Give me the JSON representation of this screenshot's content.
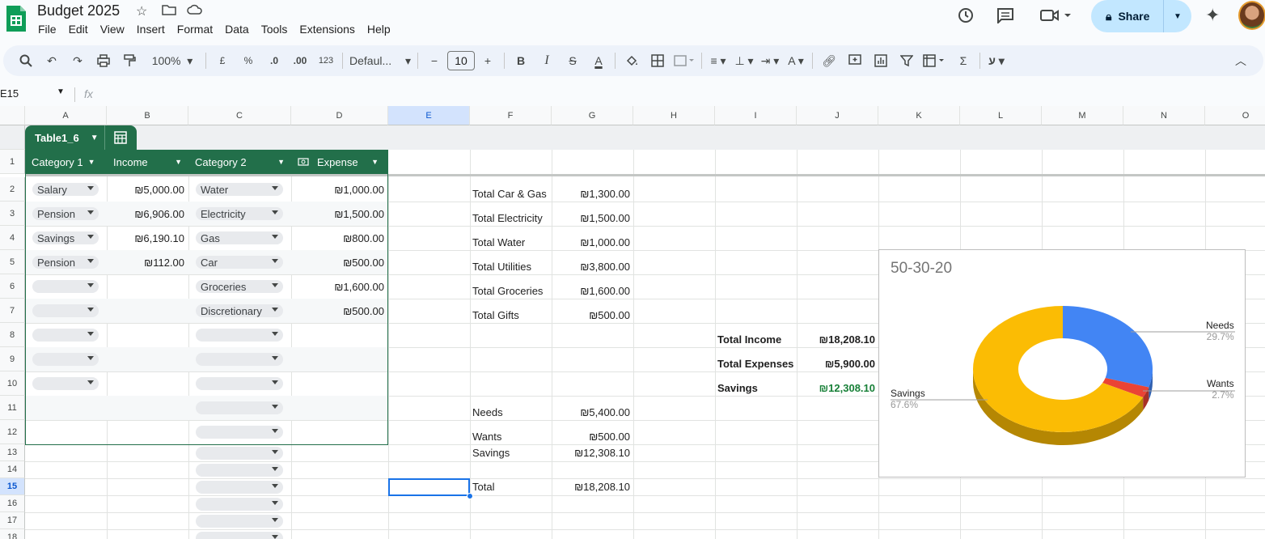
{
  "app": {
    "title": "Budget 2025",
    "menus": [
      "File",
      "Edit",
      "View",
      "Insert",
      "Format",
      "Data",
      "Tools",
      "Extensions",
      "Help"
    ],
    "share_label": "Share"
  },
  "toolbar": {
    "zoom": "100%",
    "currency": "£",
    "percent": "%",
    "dec_decrease": ".0",
    "dec_increase": ".00",
    "number_format": "123",
    "font": "Defaul...",
    "font_size": "10"
  },
  "formula_bar": {
    "name_box": "E15",
    "fx": "fx"
  },
  "columns": [
    "A",
    "B",
    "C",
    "D",
    "E",
    "F",
    "G",
    "H",
    "I",
    "J",
    "K",
    "L",
    "M",
    "N",
    "O"
  ],
  "rows": [
    "1",
    "2",
    "3",
    "4",
    "5",
    "6",
    "7",
    "8",
    "9",
    "10",
    "11",
    "12",
    "13",
    "14",
    "15",
    "16",
    "17",
    "18"
  ],
  "table": {
    "name": "Table1_6",
    "headers": [
      "Category 1",
      "Income",
      "Category 2",
      "Expense"
    ],
    "rows": [
      {
        "cat1": "Salary",
        "income": "₪5,000.00",
        "cat2": "Water",
        "expense": "₪1,000.00"
      },
      {
        "cat1": "Pension",
        "income": "₪6,906.00",
        "cat2": "Electricity",
        "expense": "₪1,500.00"
      },
      {
        "cat1": "Savings",
        "income": "₪6,190.10",
        "cat2": "Gas",
        "expense": "₪800.00"
      },
      {
        "cat1": "Pension",
        "income": "₪112.00",
        "cat2": "Car",
        "expense": "₪500.00"
      },
      {
        "cat1": "",
        "income": "",
        "cat2": "Groceries",
        "expense": "₪1,600.00"
      },
      {
        "cat1": "",
        "income": "",
        "cat2": "Discretionary",
        "expense": "₪500.00"
      },
      {
        "cat1": "",
        "income": "",
        "cat2": "",
        "expense": ""
      },
      {
        "cat1": "",
        "income": "",
        "cat2": "",
        "expense": ""
      },
      {
        "cat1": "",
        "income": "",
        "cat2": "",
        "expense": ""
      },
      {
        "cat1": null,
        "income": "",
        "cat2": "",
        "expense": ""
      },
      {
        "cat1": null,
        "income": "",
        "cat2": "",
        "expense": ""
      }
    ]
  },
  "summary": {
    "totals": [
      {
        "label": "Total Car & Gas",
        "value": "₪1,300.00"
      },
      {
        "label": "Total Electricity",
        "value": "₪1,500.00"
      },
      {
        "label": "Total Water",
        "value": "₪1,000.00"
      },
      {
        "label": "Total Utilities",
        "value": "₪3,800.00"
      },
      {
        "label": "Total Groceries",
        "value": "₪1,600.00"
      },
      {
        "label": "Total Gifts",
        "value": "₪500.00"
      }
    ],
    "income_block": [
      {
        "label": "Total Income",
        "value": "₪18,208.10"
      },
      {
        "label": "Total Expenses",
        "value": "₪5,900.00"
      },
      {
        "label": "Savings",
        "value": "₪12,308.10"
      }
    ],
    "split": [
      {
        "label": "Needs",
        "value": "₪5,400.00"
      },
      {
        "label": "Wants",
        "value": "₪500.00"
      },
      {
        "label": "Savings",
        "value": "₪12,308.10"
      }
    ],
    "total_label": "Total",
    "total_value": "₪18,208.10"
  },
  "chart_data": {
    "type": "pie",
    "title": "50-30-20",
    "labels": [
      "Needs",
      "Wants",
      "Savings"
    ],
    "values": [
      5400,
      500,
      12308.1
    ],
    "percent_labels": [
      "29.7%",
      "2.7%",
      "67.6%"
    ],
    "colors": [
      "#4285f4",
      "#ea4335",
      "#fbbc04"
    ],
    "donut": true,
    "legend": "labeled"
  }
}
